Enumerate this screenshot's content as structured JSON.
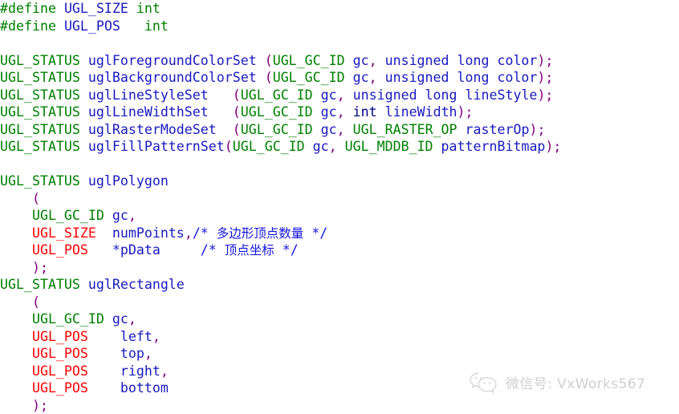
{
  "document": {
    "type": "source-code-listing",
    "language": "C",
    "background_color": "#ffffff",
    "colors": {
      "keyword_green": "#008000",
      "identifier_blue": "#1a1ac0",
      "type_navy": "#000080",
      "macro_red": "#ff0000",
      "punctuation_purple": "#800080",
      "comment_blue": "#1515e0"
    }
  },
  "code": {
    "lines": [
      [
        {
          "t": "#define ",
          "c": "green"
        },
        {
          "t": "UGL_SIZE",
          "c": "blue"
        },
        {
          "t": " ",
          "c": "plain"
        },
        {
          "t": "int",
          "c": "green"
        }
      ],
      [
        {
          "t": "#define ",
          "c": "green"
        },
        {
          "t": "UGL_POS",
          "c": "blue"
        },
        {
          "t": "   ",
          "c": "plain"
        },
        {
          "t": "int",
          "c": "green"
        }
      ],
      [],
      [
        {
          "t": "UGL_STATUS",
          "c": "green"
        },
        {
          "t": " ",
          "c": "plain"
        },
        {
          "t": "uglForegroundColorSet",
          "c": "blue"
        },
        {
          "t": " ",
          "c": "plain"
        },
        {
          "t": "(",
          "c": "purple"
        },
        {
          "t": "UGL_GC_ID",
          "c": "green"
        },
        {
          "t": " gc",
          "c": "blue"
        },
        {
          "t": ",",
          "c": "purple"
        },
        {
          "t": " unsigned long color",
          "c": "blue"
        },
        {
          "t": ");",
          "c": "purple"
        }
      ],
      [
        {
          "t": "UGL_STATUS",
          "c": "green"
        },
        {
          "t": " ",
          "c": "plain"
        },
        {
          "t": "uglBackgroundColorSet",
          "c": "blue"
        },
        {
          "t": " ",
          "c": "plain"
        },
        {
          "t": "(",
          "c": "purple"
        },
        {
          "t": "UGL_GC_ID",
          "c": "green"
        },
        {
          "t": " gc",
          "c": "blue"
        },
        {
          "t": ",",
          "c": "purple"
        },
        {
          "t": " unsigned long color",
          "c": "blue"
        },
        {
          "t": ");",
          "c": "purple"
        }
      ],
      [
        {
          "t": "UGL_STATUS",
          "c": "green"
        },
        {
          "t": " ",
          "c": "plain"
        },
        {
          "t": "uglLineStyleSet",
          "c": "blue"
        },
        {
          "t": "   ",
          "c": "plain"
        },
        {
          "t": "(",
          "c": "purple"
        },
        {
          "t": "UGL_GC_ID",
          "c": "green"
        },
        {
          "t": " gc",
          "c": "blue"
        },
        {
          "t": ",",
          "c": "purple"
        },
        {
          "t": " unsigned long lineStyle",
          "c": "blue"
        },
        {
          "t": ");",
          "c": "purple"
        }
      ],
      [
        {
          "t": "UGL_STATUS",
          "c": "green"
        },
        {
          "t": " ",
          "c": "plain"
        },
        {
          "t": "uglLineWidthSet",
          "c": "blue"
        },
        {
          "t": "   ",
          "c": "plain"
        },
        {
          "t": "(",
          "c": "purple"
        },
        {
          "t": "UGL_GC_ID",
          "c": "green"
        },
        {
          "t": " gc",
          "c": "blue"
        },
        {
          "t": ",",
          "c": "purple"
        },
        {
          "t": " ",
          "c": "plain"
        },
        {
          "t": "int",
          "c": "navy"
        },
        {
          "t": " lineWidth",
          "c": "blue"
        },
        {
          "t": ");",
          "c": "purple"
        }
      ],
      [
        {
          "t": "UGL_STATUS",
          "c": "green"
        },
        {
          "t": " ",
          "c": "plain"
        },
        {
          "t": "uglRasterModeSet",
          "c": "blue"
        },
        {
          "t": "  ",
          "c": "plain"
        },
        {
          "t": "(",
          "c": "purple"
        },
        {
          "t": "UGL_GC_ID",
          "c": "green"
        },
        {
          "t": " gc",
          "c": "blue"
        },
        {
          "t": ",",
          "c": "purple"
        },
        {
          "t": " ",
          "c": "plain"
        },
        {
          "t": "UGL_RASTER_OP",
          "c": "green"
        },
        {
          "t": " rasterOp",
          "c": "blue"
        },
        {
          "t": ");",
          "c": "purple"
        }
      ],
      [
        {
          "t": "UGL_STATUS",
          "c": "green"
        },
        {
          "t": " ",
          "c": "plain"
        },
        {
          "t": "uglFillPatternSet",
          "c": "blue"
        },
        {
          "t": "(",
          "c": "purple"
        },
        {
          "t": "UGL_GC_ID",
          "c": "green"
        },
        {
          "t": " gc",
          "c": "blue"
        },
        {
          "t": ",",
          "c": "purple"
        },
        {
          "t": " ",
          "c": "plain"
        },
        {
          "t": "UGL_MDDB_ID",
          "c": "green"
        },
        {
          "t": " patternBitmap",
          "c": "blue"
        },
        {
          "t": ");",
          "c": "purple"
        }
      ],
      [],
      [
        {
          "t": "UGL_STATUS",
          "c": "green"
        },
        {
          "t": " ",
          "c": "plain"
        },
        {
          "t": "uglPolygon",
          "c": "blue"
        }
      ],
      [
        {
          "t": "    ",
          "c": "plain"
        },
        {
          "t": "(",
          "c": "purple"
        }
      ],
      [
        {
          "t": "    ",
          "c": "plain"
        },
        {
          "t": "UGL_GC_ID",
          "c": "green"
        },
        {
          "t": " gc",
          "c": "blue"
        },
        {
          "t": ",",
          "c": "purple"
        }
      ],
      [
        {
          "t": "    ",
          "c": "plain"
        },
        {
          "t": "UGL_SIZE",
          "c": "red"
        },
        {
          "t": "  numPoints",
          "c": "blue"
        },
        {
          "t": ",",
          "c": "purple"
        },
        {
          "t": "/* ",
          "c": "comment"
        },
        {
          "t": "多边形顶点数量",
          "c": "comment",
          "cjk": true
        },
        {
          "t": " */",
          "c": "comment"
        }
      ],
      [
        {
          "t": "    ",
          "c": "plain"
        },
        {
          "t": "UGL_POS",
          "c": "red"
        },
        {
          "t": "   *pData",
          "c": "blue"
        },
        {
          "t": "     ",
          "c": "plain"
        },
        {
          "t": "/* ",
          "c": "comment"
        },
        {
          "t": "顶点坐标",
          "c": "comment",
          "cjk": true
        },
        {
          "t": " */",
          "c": "comment"
        }
      ],
      [
        {
          "t": "    ",
          "c": "plain"
        },
        {
          "t": ");",
          "c": "purple"
        }
      ],
      [
        {
          "t": "UGL_STATUS",
          "c": "green"
        },
        {
          "t": " ",
          "c": "plain"
        },
        {
          "t": "uglRectangle",
          "c": "blue"
        }
      ],
      [
        {
          "t": "    ",
          "c": "plain"
        },
        {
          "t": "(",
          "c": "purple"
        }
      ],
      [
        {
          "t": "    ",
          "c": "plain"
        },
        {
          "t": "UGL_GC_ID",
          "c": "green"
        },
        {
          "t": " gc",
          "c": "blue"
        },
        {
          "t": ",",
          "c": "purple"
        }
      ],
      [
        {
          "t": "    ",
          "c": "plain"
        },
        {
          "t": "UGL_POS",
          "c": "red"
        },
        {
          "t": "    left",
          "c": "blue"
        },
        {
          "t": ",",
          "c": "purple"
        }
      ],
      [
        {
          "t": "    ",
          "c": "plain"
        },
        {
          "t": "UGL_POS",
          "c": "red"
        },
        {
          "t": "    top",
          "c": "blue"
        },
        {
          "t": ",",
          "c": "purple"
        }
      ],
      [
        {
          "t": "    ",
          "c": "plain"
        },
        {
          "t": "UGL_POS",
          "c": "red"
        },
        {
          "t": "    right",
          "c": "blue"
        },
        {
          "t": ",",
          "c": "purple"
        }
      ],
      [
        {
          "t": "    ",
          "c": "plain"
        },
        {
          "t": "UGL_POS",
          "c": "red"
        },
        {
          "t": "    bottom",
          "c": "blue"
        }
      ],
      [
        {
          "t": "    ",
          "c": "plain"
        },
        {
          "t": ");",
          "c": "purple"
        }
      ]
    ],
    "plain_text": [
      "#define UGL_SIZE int",
      "#define UGL_POS   int",
      "",
      "UGL_STATUS uglForegroundColorSet (UGL_GC_ID gc, unsigned long color);",
      "UGL_STATUS uglBackgroundColorSet (UGL_GC_ID gc, unsigned long color);",
      "UGL_STATUS uglLineStyleSet   (UGL_GC_ID gc, unsigned long lineStyle);",
      "UGL_STATUS uglLineWidthSet   (UGL_GC_ID gc, int lineWidth);",
      "UGL_STATUS uglRasterModeSet  (UGL_GC_ID gc, UGL_RASTER_OP rasterOp);",
      "UGL_STATUS uglFillPatternSet(UGL_GC_ID gc, UGL_MDDB_ID patternBitmap);",
      "",
      "UGL_STATUS uglPolygon",
      "    (",
      "    UGL_GC_ID gc,",
      "    UGL_SIZE  numPoints,/* 多边形顶点数量 */",
      "    UGL_POS   *pData     /* 顶点坐标 */",
      "    );",
      "UGL_STATUS uglRectangle",
      "    (",
      "    UGL_GC_ID gc,",
      "    UGL_POS    left,",
      "    UGL_POS    top,",
      "    UGL_POS    right,",
      "    UGL_POS    bottom",
      "    );"
    ]
  },
  "watermark": {
    "icon": "wechat-icon",
    "text": "微信号: VxWorks567",
    "color": "#8e8e8e"
  }
}
